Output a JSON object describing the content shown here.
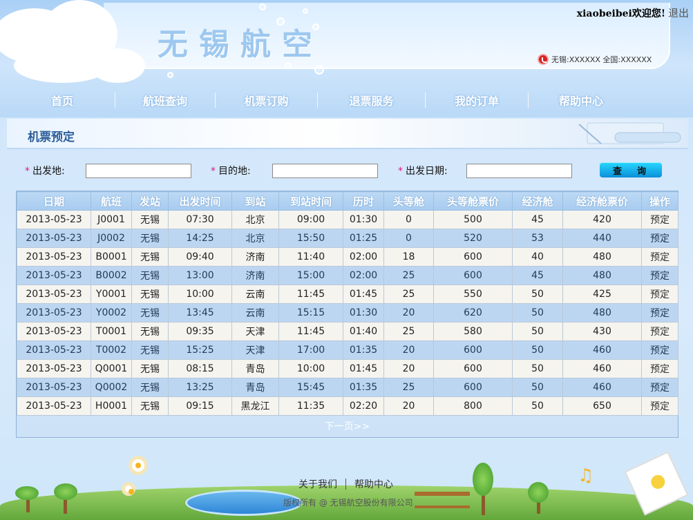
{
  "header": {
    "site_title": "无锡航空",
    "welcome": "xiaobeibei欢迎您!",
    "logout": "退出",
    "phone_line": "无锡:XXXXXX 全国:XXXXXX"
  },
  "nav": {
    "items": [
      {
        "label": "首页"
      },
      {
        "label": "航班查询"
      },
      {
        "label": "机票订购"
      },
      {
        "label": "退票服务"
      },
      {
        "label": "我的订单"
      },
      {
        "label": "帮助中心"
      }
    ]
  },
  "section": {
    "title": "机票预定"
  },
  "search": {
    "required_mark": "*",
    "from_label": "出发地:",
    "from_value": "",
    "to_label": "目的地:",
    "to_value": "",
    "date_label": "出发日期:",
    "date_value": "",
    "query_button": "查询"
  },
  "table": {
    "headers": [
      "日期",
      "航班",
      "发站",
      "出发时间",
      "到站",
      "到站时间",
      "历时",
      "头等舱",
      "头等舱票价",
      "经济舱",
      "经济舱票价",
      "操作"
    ],
    "rows": [
      [
        "2013-05-23",
        "J0001",
        "无锡",
        "07:30",
        "北京",
        "09:00",
        "01:30",
        "0",
        "500",
        "45",
        "420",
        "预定"
      ],
      [
        "2013-05-23",
        "J0002",
        "无锡",
        "14:25",
        "北京",
        "15:50",
        "01:25",
        "0",
        "520",
        "53",
        "440",
        "预定"
      ],
      [
        "2013-05-23",
        "B0001",
        "无锡",
        "09:40",
        "济南",
        "11:40",
        "02:00",
        "18",
        "600",
        "40",
        "480",
        "预定"
      ],
      [
        "2013-05-23",
        "B0002",
        "无锡",
        "13:00",
        "济南",
        "15:00",
        "02:00",
        "25",
        "600",
        "45",
        "480",
        "预定"
      ],
      [
        "2013-05-23",
        "Y0001",
        "无锡",
        "10:00",
        "云南",
        "11:45",
        "01:45",
        "25",
        "550",
        "50",
        "425",
        "预定"
      ],
      [
        "2013-05-23",
        "Y0002",
        "无锡",
        "13:45",
        "云南",
        "15:15",
        "01:30",
        "20",
        "620",
        "50",
        "480",
        "预定"
      ],
      [
        "2013-05-23",
        "T0001",
        "无锡",
        "09:35",
        "天津",
        "11:45",
        "01:40",
        "25",
        "580",
        "50",
        "430",
        "预定"
      ],
      [
        "2013-05-23",
        "T0002",
        "无锡",
        "15:25",
        "天津",
        "17:00",
        "01:35",
        "20",
        "600",
        "50",
        "460",
        "预定"
      ],
      [
        "2013-05-23",
        "Q0001",
        "无锡",
        "08:15",
        "青岛",
        "10:00",
        "01:45",
        "20",
        "600",
        "50",
        "460",
        "预定"
      ],
      [
        "2013-05-23",
        "Q0002",
        "无锡",
        "13:25",
        "青岛",
        "15:45",
        "01:35",
        "25",
        "600",
        "50",
        "460",
        "预定"
      ],
      [
        "2013-05-23",
        "H0001",
        "无锡",
        "09:15",
        "黑龙江",
        "11:35",
        "02:20",
        "20",
        "800",
        "50",
        "650",
        "预定"
      ]
    ],
    "next_page": "下一页>>"
  },
  "footer": {
    "about": "关于我们",
    "help": "帮助中心",
    "copyright": "版权所有 @ 无锡航空股份有限公司"
  },
  "colors": {
    "accent": "#2e5e9a",
    "required_star": "#e0167f",
    "row_even": "#bcd6f2",
    "row_odd": "#f6f4ef"
  },
  "icons": [
    "phone-icon",
    "music-note-icon",
    "sun-icon"
  ]
}
